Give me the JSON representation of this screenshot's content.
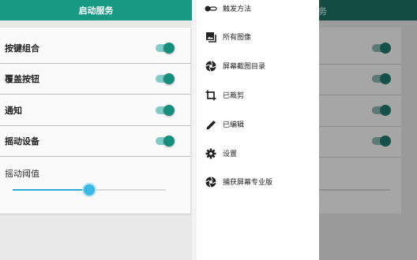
{
  "main": {
    "header_title": "启动服务",
    "settings": [
      {
        "label": "按键组合",
        "on": true
      },
      {
        "label": "覆盖按钮",
        "on": true
      },
      {
        "label": "通知",
        "on": true
      },
      {
        "label": "摇动设备",
        "on": true
      }
    ],
    "slider_label": "摇动阈值",
    "slider_value": 0.5
  },
  "background_header_fragment": "务",
  "drawer": {
    "items": [
      {
        "label": "触发方法",
        "icon": "toggle-icon"
      },
      {
        "label": "所有图像",
        "icon": "gallery-icon"
      },
      {
        "label": "屏幕截图目录",
        "icon": "aperture-icon"
      },
      {
        "label": "已裁剪",
        "icon": "crop-icon"
      },
      {
        "label": "已编辑",
        "icon": "pencil-icon"
      },
      {
        "label": "设置",
        "icon": "gear-icon"
      },
      {
        "label": "捕获屏幕专业版",
        "icon": "aperture-icon"
      }
    ]
  },
  "colors": {
    "primary": "#179983",
    "accent": "#178e7c",
    "slider": "#3bb8e4"
  }
}
